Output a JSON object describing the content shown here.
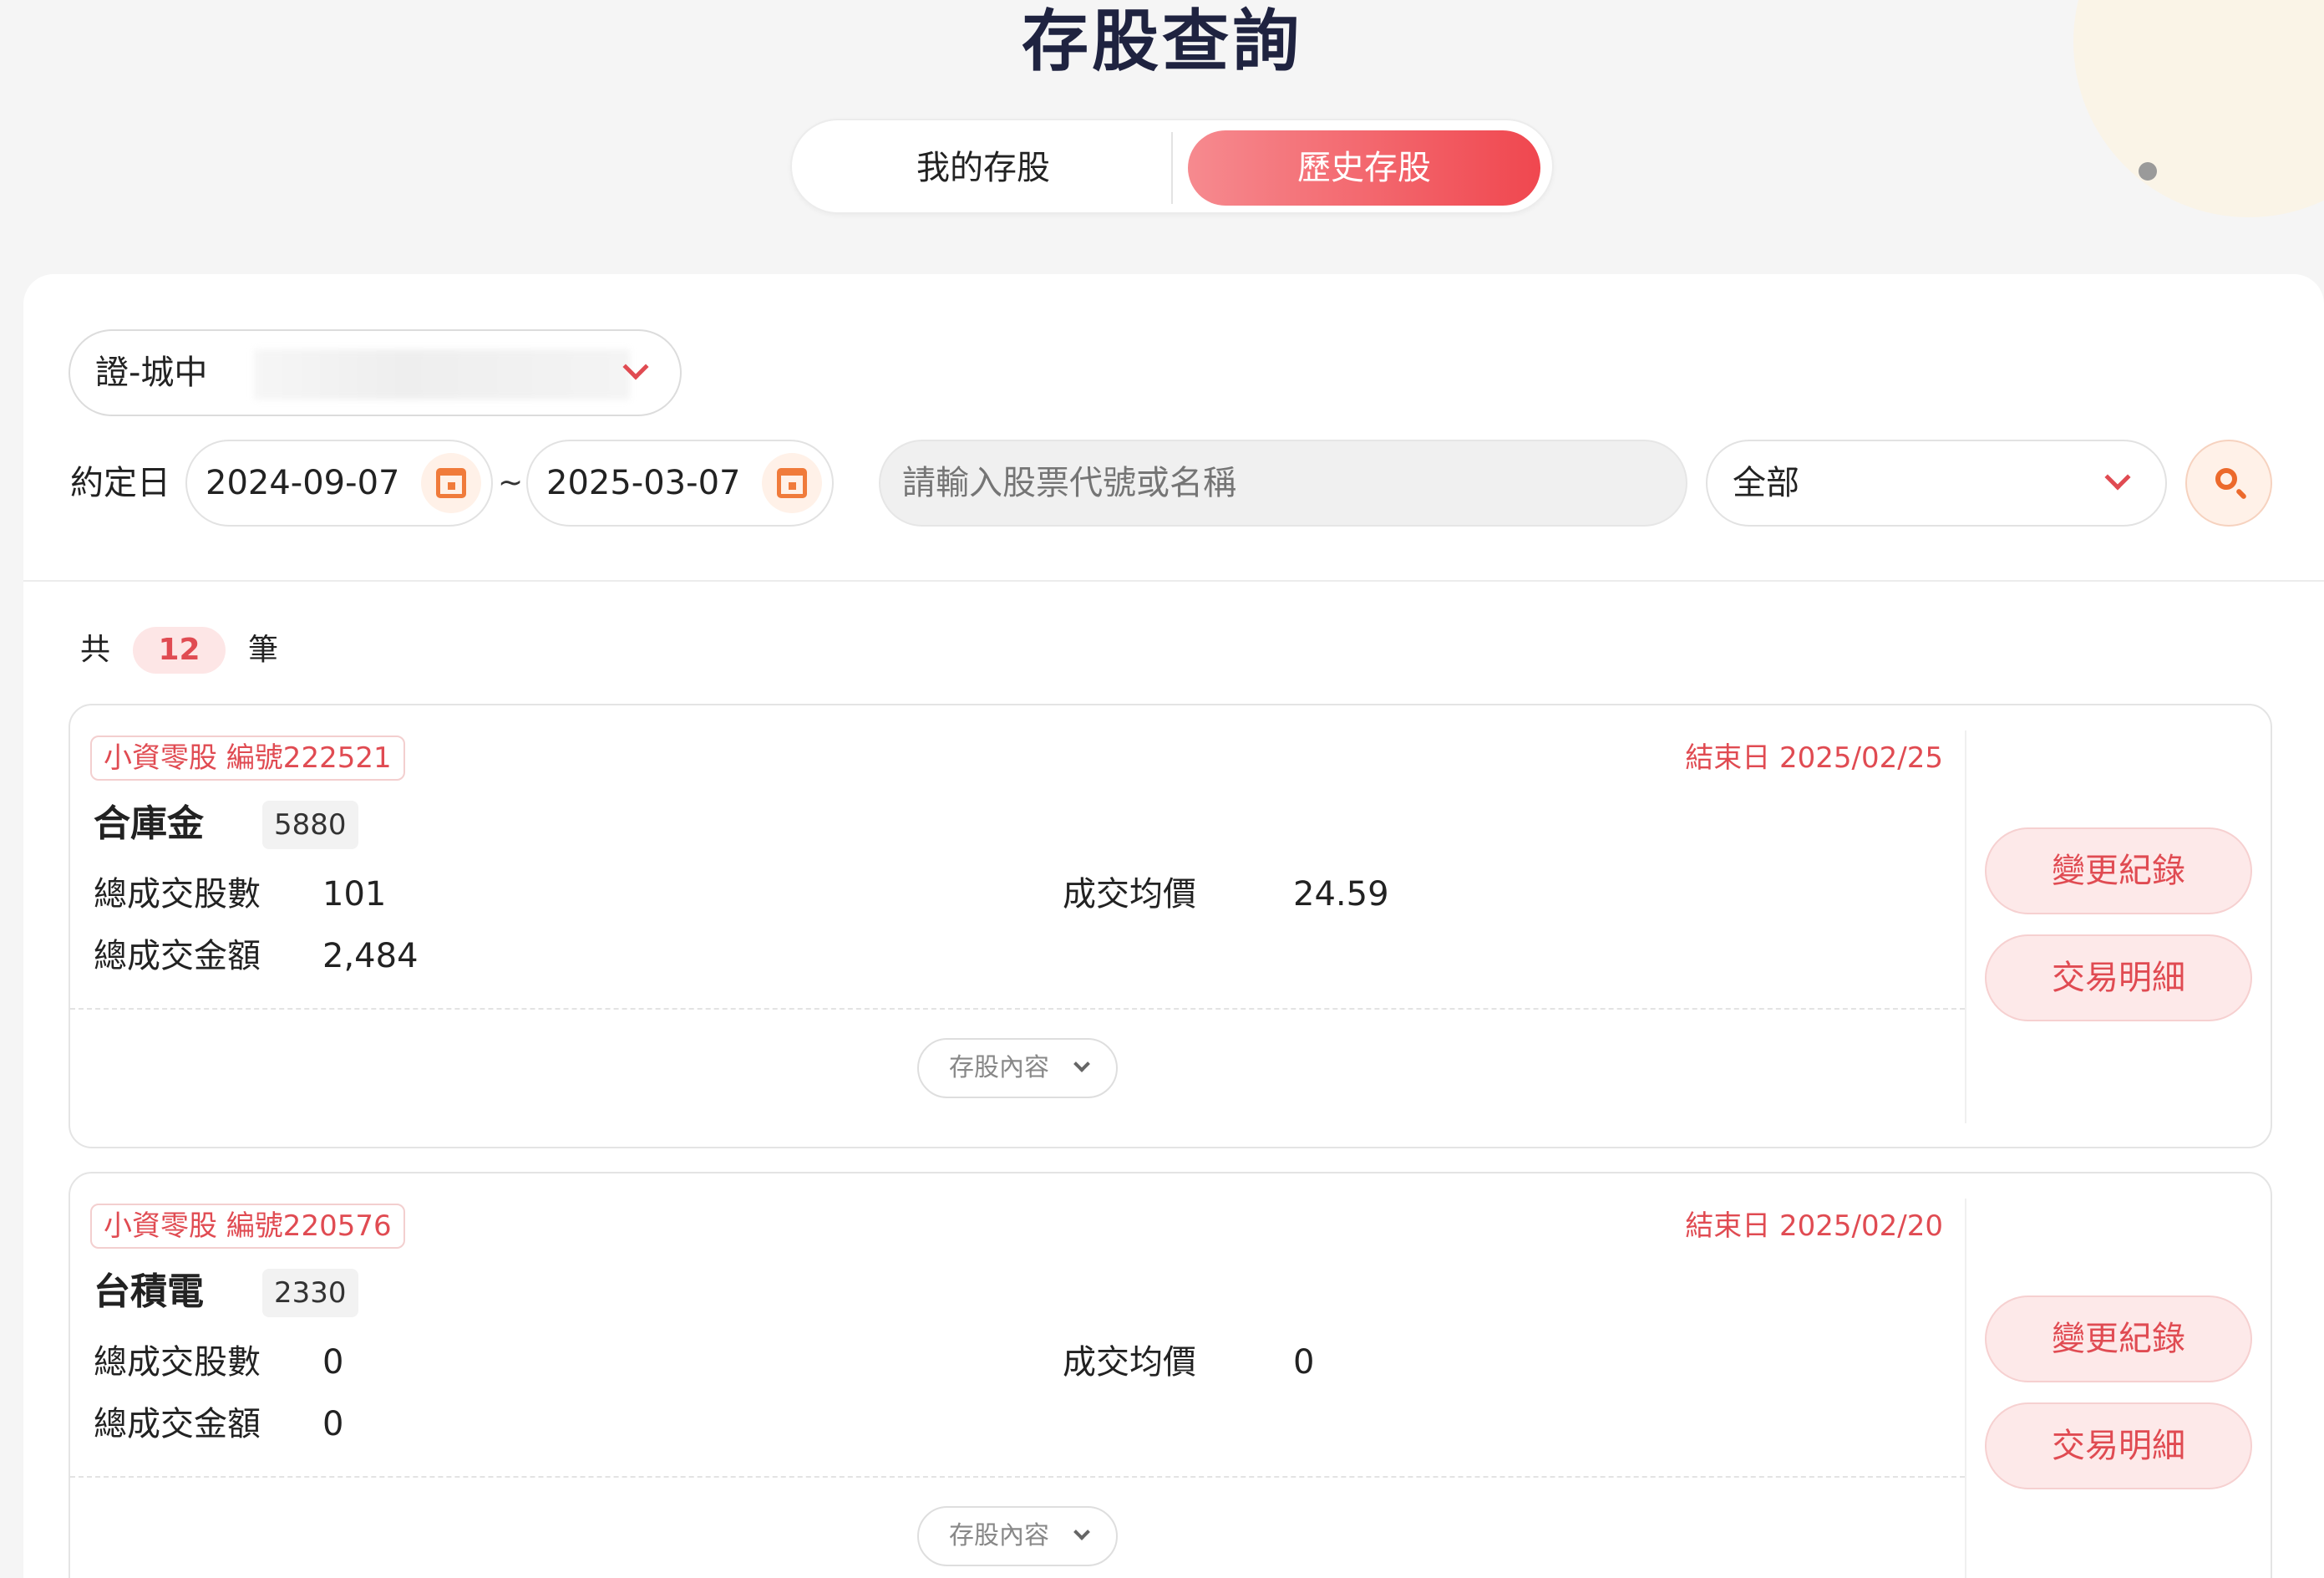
{
  "page": {
    "title": "存股查詢"
  },
  "tabs": [
    {
      "label": "我的存股",
      "active": false
    },
    {
      "label": "歷史存股",
      "active": true
    }
  ],
  "filters": {
    "account_label": "證-城中",
    "date_label": "約定日",
    "start_date": "2024-09-07",
    "end_date": "2025-03-07",
    "date_separator": "~",
    "search_placeholder": "請輸入股票代號或名稱",
    "category_value": "全部"
  },
  "summary": {
    "prefix": "共",
    "count": "12",
    "suffix": "筆"
  },
  "colors": {
    "accent": "#f0474f",
    "accent_soft": "#fde9e9",
    "orange": "#f07b3b",
    "title": "#1f2340"
  },
  "records": [
    {
      "tag": "小資零股 編號222521",
      "end_date": "結束日 2025/02/25",
      "name": "合庫金",
      "code": "5880",
      "total_shares_label": "總成交股數",
      "total_shares": "101",
      "avg_price_label": "成交均價",
      "avg_price": "24.59",
      "total_amount_label": "總成交金額",
      "total_amount": "2,484",
      "expand_label": "存股內容",
      "change_log_label": "變更紀錄",
      "trade_detail_label": "交易明細"
    },
    {
      "tag": "小資零股 編號220576",
      "end_date": "結束日 2025/02/20",
      "name": "台積電",
      "code": "2330",
      "total_shares_label": "總成交股數",
      "total_shares": "0",
      "avg_price_label": "成交均價",
      "avg_price": "0",
      "total_amount_label": "總成交金額",
      "total_amount": "0",
      "expand_label": "存股內容",
      "change_log_label": "變更紀錄",
      "trade_detail_label": "交易明細"
    }
  ]
}
